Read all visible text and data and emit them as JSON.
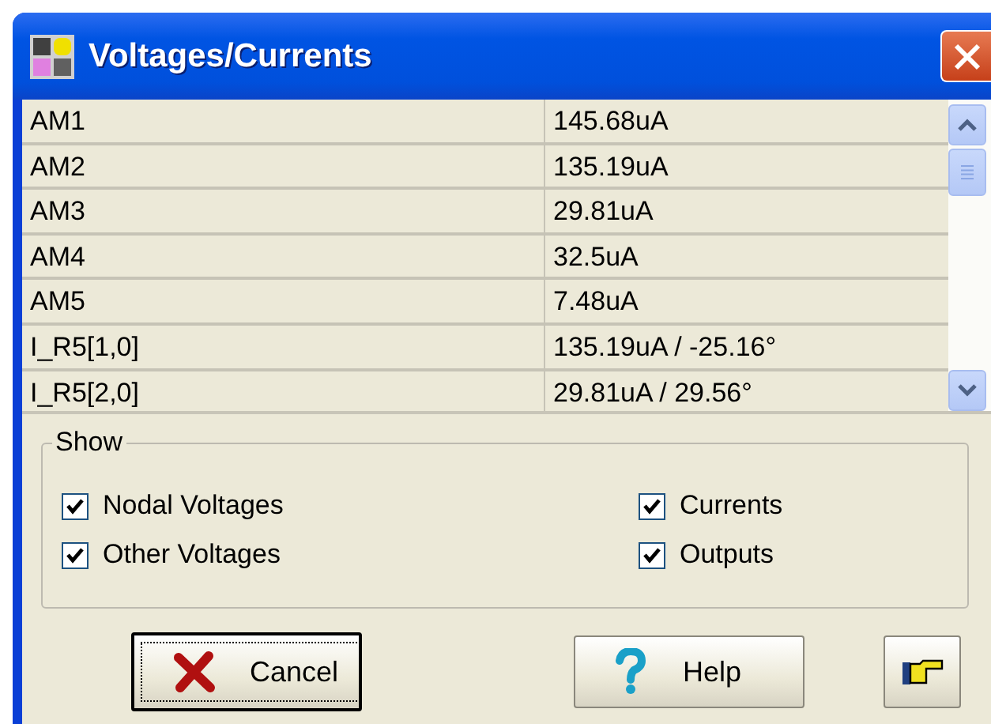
{
  "window": {
    "title": "Voltages/Currents"
  },
  "table": {
    "rows": [
      {
        "name": "AM1",
        "value": "145.68uA"
      },
      {
        "name": "AM2",
        "value": "135.19uA"
      },
      {
        "name": "AM3",
        "value": "29.81uA"
      },
      {
        "name": "AM4",
        "value": "32.5uA"
      },
      {
        "name": "AM5",
        "value": "7.48uA"
      },
      {
        "name": "I_R5[1,0]",
        "value": "135.19uA / -25.16°"
      },
      {
        "name": "I_R5[2,0]",
        "value": "29.81uA / 29.56°"
      }
    ]
  },
  "show": {
    "title": "Show",
    "options": [
      {
        "label": "Nodal Voltages",
        "checked": true
      },
      {
        "label": "Currents",
        "checked": true
      },
      {
        "label": "Other Voltages",
        "checked": true
      },
      {
        "label": "Outputs",
        "checked": true
      }
    ]
  },
  "buttons": [
    {
      "kind": "cancel",
      "label": "Cancel",
      "default": true
    },
    {
      "kind": "help",
      "label": "Help",
      "default": false
    },
    {
      "kind": "pointer",
      "default": false
    }
  ]
}
